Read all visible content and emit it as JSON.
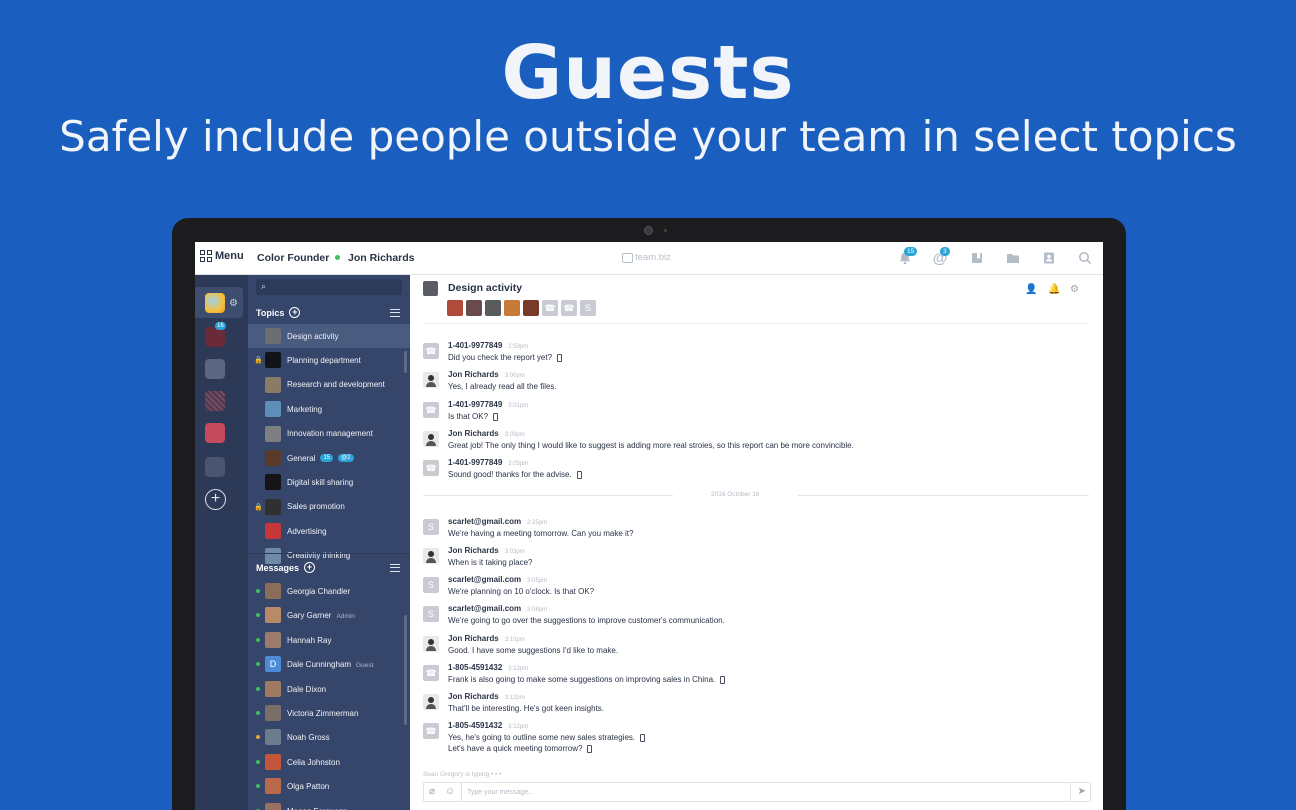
{
  "hero": {
    "title": "Guests",
    "subtitle": "Safely include people outside your team in select topics"
  },
  "topbar": {
    "menu_label": "Menu",
    "team_name": "Color Founder",
    "user_name": "Jon Richards",
    "brand": "team.biz",
    "notifications_count": "15",
    "mentions_count": "3"
  },
  "rail": {
    "badge_count": "16"
  },
  "sidebar": {
    "topics_label": "Topics",
    "topics": [
      {
        "label": "Design activity",
        "locked": false,
        "thumb_color": "#6b6e73"
      },
      {
        "label": "Planning department",
        "locked": true,
        "thumb_color": "#111418"
      },
      {
        "label": "Research and development",
        "locked": false,
        "thumb_color": "#8a7a68"
      },
      {
        "label": "Marketing",
        "locked": false,
        "thumb_color": "#5d8fb8"
      },
      {
        "label": "Innovation management",
        "locked": false,
        "thumb_color": "#7d7f82"
      },
      {
        "label": "General",
        "locked": false,
        "thumb_color": "#5a3a28",
        "count": "15",
        "mention": "@2"
      },
      {
        "label": "Digital skill sharing",
        "locked": false,
        "thumb_color": "#151515"
      },
      {
        "label": "Sales promotion",
        "locked": true,
        "thumb_color": "#303030"
      },
      {
        "label": "Advertising",
        "locked": false,
        "thumb_color": "#c4383a"
      },
      {
        "label": "Creativity thinking",
        "locked": false,
        "thumb_color": "#6f8aa8"
      }
    ],
    "messages_label": "Messages",
    "messages": [
      {
        "name": "Georgia Chandler",
        "role": "",
        "presence": "#3cbf5c",
        "avatar_color": "#8a6e58"
      },
      {
        "name": "Gary Garner",
        "role": "Admin",
        "presence": "#3cbf5c",
        "avatar_color": "#b88a6a"
      },
      {
        "name": "Hannah Ray",
        "role": "",
        "presence": "#3cbf5c",
        "avatar_color": "#9b7b6b"
      },
      {
        "name": "Dale Cunningham",
        "role": "Guest",
        "presence": "#3cbf5c",
        "avatar_color": "#4a8cd8",
        "initial": "D"
      },
      {
        "name": "Dale Dixon",
        "role": "",
        "presence": "#3cbf5c",
        "avatar_color": "#a07a60"
      },
      {
        "name": "Victoria Zimmerman",
        "role": "",
        "presence": "#3cbf5c",
        "avatar_color": "#7a6f68"
      },
      {
        "name": "Noah Gross",
        "role": "",
        "presence": "#e8a33a",
        "avatar_color": "#6b7c8e"
      },
      {
        "name": "Celia Johnston",
        "role": "",
        "presence": "#3cbf5c",
        "avatar_color": "#c2553a"
      },
      {
        "name": "Olga Patton",
        "role": "",
        "presence": "#3cbf5c",
        "avatar_color": "#b86a4a"
      },
      {
        "name": "Megan Ferguson",
        "role": "",
        "presence": "#3cbf5c",
        "avatar_color": "#9a7060"
      }
    ]
  },
  "chat": {
    "title": "Design activity",
    "members": [
      "#b04a3a",
      "#6a4a4a",
      "#5a5a5a",
      "#c87a3a",
      "#7a3a2a"
    ],
    "member_placeholders": [
      "☎",
      "☎",
      "S"
    ],
    "date_separator": "2016 October 16",
    "typing": "Sean Gregory is typing • • •",
    "composer_placeholder": "Type your message...",
    "messages": [
      {
        "avatar": "☎",
        "jon": false,
        "author": "1-401-9977849",
        "time": "2:59pm",
        "lines": [
          "Did you check the report yet?"
        ],
        "mobile": true
      },
      {
        "avatar": "",
        "jon": true,
        "author": "Jon Richards",
        "time": "3:00pm",
        "lines": [
          "Yes, I already read all the files."
        ],
        "mobile": false
      },
      {
        "avatar": "☎",
        "jon": false,
        "author": "1-401-9977849",
        "time": "3:01pm",
        "lines": [
          "Is that OK?"
        ],
        "mobile": true
      },
      {
        "avatar": "",
        "jon": true,
        "author": "Jon Richards",
        "time": "3:03pm",
        "lines": [
          "Great job! The only thing I would like to suggest is adding more real stroies, so this report can be more convincible."
        ],
        "mobile": false
      },
      {
        "avatar": "☎",
        "jon": false,
        "author": "1-401-9977849",
        "time": "3:05pm",
        "lines": [
          "Sound good! thanks for the advise."
        ],
        "mobile": true
      },
      {
        "avatar": "S",
        "jon": false,
        "author": "scarlet@gmail.com",
        "time": "2:25pm",
        "lines": [
          "We're having a meeting tomorrow. Can you make it?"
        ],
        "mobile": false
      },
      {
        "avatar": "",
        "jon": true,
        "author": "Jon Richards",
        "time": "3:03pm",
        "lines": [
          " When is it taking place?"
        ],
        "mobile": false
      },
      {
        "avatar": "S",
        "jon": false,
        "author": "scarlet@gmail.com",
        "time": "3:05pm",
        "lines": [
          "We're planning on 10 o'clock. Is that OK?"
        ],
        "mobile": false
      },
      {
        "avatar": "S",
        "jon": false,
        "author": "scarlet@gmail.com",
        "time": "3:08pm",
        "lines": [
          "We're going to go over the suggestions to improve customer's communication."
        ],
        "mobile": false
      },
      {
        "avatar": "",
        "jon": true,
        "author": "Jon Richards",
        "time": "3:10pm",
        "lines": [
          "Good. I have some suggestions I'd like to make."
        ],
        "mobile": false
      },
      {
        "avatar": "☎",
        "jon": false,
        "author": "1-805-4591432",
        "time": "3:12pm",
        "lines": [
          "Frank is also going to make some suggestions on improving sales in China."
        ],
        "mobile": true
      },
      {
        "avatar": "",
        "jon": true,
        "author": "Jon Richards",
        "time": "3:12pm",
        "lines": [
          "That'll be interesting. He's got keen insights."
        ],
        "mobile": false
      },
      {
        "avatar": "☎",
        "jon": false,
        "author": "1-805-4591432",
        "time": "3:12pm",
        "lines": [
          "Yes, he's going to outline some new sales strategies.",
          "Let's have a quick meeting tomorrow?"
        ],
        "mobile": true
      }
    ]
  },
  "colors": {
    "background": "#1a5fbf",
    "rail": "#2c3a58",
    "sidebar": "#36466a",
    "accent_badge": "#2aa3d8"
  }
}
